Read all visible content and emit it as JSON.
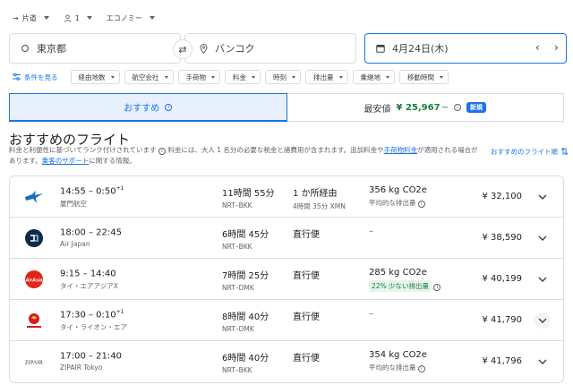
{
  "top_options": {
    "trip_type": "片道",
    "passengers": "1",
    "cabin": "エコノミー"
  },
  "search": {
    "origin": "東京都",
    "destination": "バンコク",
    "date": "4月24日(木)"
  },
  "filters": {
    "label": "条件を見る",
    "chips": [
      "経由地数",
      "航空会社",
      "手荷物",
      "料金",
      "時刻",
      "排出量",
      "乗継地",
      "移動時間"
    ]
  },
  "tabs": {
    "recommended": "おすすめ",
    "cheapest_label": "最安値",
    "cheapest_price": "¥ 25,967",
    "tilde": "~",
    "new_badge": "新規"
  },
  "heading": "おすすめのフライト",
  "subtext": {
    "part1": "料金と利便性に基づいてランク付けされています",
    "part2": "料金には、大人 1 名分の必要な税金と諸費用が含まれます。追加料金や",
    "link1": "手荷物料金",
    "part3": "が適用される場合があります。",
    "link2": "乗客のサポート",
    "part4": "に関する情報。"
  },
  "sort_label": "おすすめのフライト順",
  "flights": [
    {
      "time": "14:55 – 0:50",
      "plus": "+1",
      "airline": "厦門航空",
      "duration": "11時間 55分",
      "route": "NRT–BKK",
      "stops": "1 か所経由",
      "stop_detail": "4時間 35分 XMN",
      "emissions": "356 kg CO2e",
      "emissions_note": "平均的な排出量",
      "emissions_badge": "",
      "price": "¥ 32,100"
    },
    {
      "time": "18:00 – 22:45",
      "plus": "",
      "airline": "Air Japan",
      "duration": "6時間 45分",
      "route": "NRT–BKK",
      "stops": "直行便",
      "stop_detail": "",
      "emissions": "–",
      "emissions_note": "",
      "emissions_badge": "",
      "price": "¥ 38,590"
    },
    {
      "time": "9:15 – 14:40",
      "plus": "",
      "airline": "タイ・エアアジアX",
      "duration": "7時間 25分",
      "route": "NRT–DMK",
      "stops": "直行便",
      "stop_detail": "",
      "emissions": "285 kg CO2e",
      "emissions_note": "",
      "emissions_badge": "22% 少ない排出量",
      "price": "¥ 40,199"
    },
    {
      "time": "17:30 – 0:10",
      "plus": "+1",
      "airline": "タイ・ライオン・エア",
      "duration": "8時間 40分",
      "route": "NRT–DMK",
      "stops": "直行便",
      "stop_detail": "",
      "emissions": "–",
      "emissions_note": "",
      "emissions_badge": "",
      "price": "¥ 41,790"
    },
    {
      "time": "17:00 – 21:40",
      "plus": "",
      "airline": "ZIPAIR Tokyo",
      "duration": "6時間 40分",
      "route": "NRT–BKK",
      "stops": "直行便",
      "stop_detail": "",
      "emissions": "354 kg CO2e",
      "emissions_note": "平均的な排出量",
      "emissions_badge": "",
      "price": "¥ 41,796"
    }
  ],
  "logos": {
    "airasia_text": "AirAsia",
    "zipair_text": "ZIPAIR"
  },
  "colors": {
    "accent": "#1a73e8",
    "green": "#188038"
  }
}
